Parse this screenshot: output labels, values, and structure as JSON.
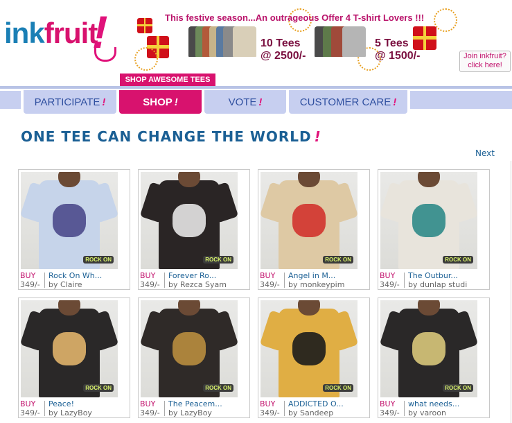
{
  "logo": {
    "part1": "ink",
    "part2": "fruit",
    "bang": "!"
  },
  "banner": {
    "headline": "This festive season...An outrageous Offer 4 T-shirt Lovers !!!",
    "offer_one_line1": "10 Tees",
    "offer_one_line2": "@ 2500/-",
    "offer_two_line1": "5 Tees",
    "offer_two_line2": "@ 1500/-"
  },
  "join": {
    "line1": "Join inkfruit?",
    "line2": "click here!"
  },
  "shop_label": "SHOP AWESOME TEES",
  "nav": {
    "tabs": [
      {
        "label": "PARTICIPATE",
        "bang": "!"
      },
      {
        "label": "SHOP",
        "bang": "!"
      },
      {
        "label": "VOTE",
        "bang": "!"
      },
      {
        "label": "CUSTOMER CARE",
        "bang": "!"
      }
    ],
    "active": "SHOP"
  },
  "page": {
    "title": "ONE TEE CAN CHANGE THE WORLD",
    "title_bang": "!",
    "next_label": "Next"
  },
  "products": [
    {
      "buy": "BUY",
      "name": "Rock On Wh...",
      "price": "349/-",
      "author": "by Claire",
      "shirt_color": "#c6d4ea",
      "print_color": "#4b4a8c",
      "tag": "ROCK ON"
    },
    {
      "buy": "BUY",
      "name": "Forever Ro...",
      "price": "349/-",
      "author": "by Rezca Syam",
      "shirt_color": "#2a2525",
      "print_color": "#e6e6e6",
      "tag": "ROCK ON"
    },
    {
      "buy": "BUY",
      "name": "Angel in M...",
      "price": "349/-",
      "author": "by monkeypim",
      "shirt_color": "#dec9a4",
      "print_color": "#d2332e",
      "tag": "ROCK ON"
    },
    {
      "buy": "BUY",
      "name": "The Outbur...",
      "price": "349/-",
      "author": "by dunlap studi",
      "shirt_color": "#e8e4dc",
      "print_color": "#2f8a88",
      "tag": "ROCK ON"
    },
    {
      "buy": "BUY",
      "name": "Peace!",
      "price": "349/-",
      "author": "by LazyBoy",
      "shirt_color": "#2a2828",
      "print_color": "#e0b36a",
      "tag": "ROCK ON"
    },
    {
      "buy": "BUY",
      "name": "The Peacem...",
      "price": "349/-",
      "author": "by LazyBoy",
      "shirt_color": "#2f2a28",
      "print_color": "#b98d3e",
      "tag": "ROCK ON"
    },
    {
      "buy": "BUY",
      "name": "ADDICTED O...",
      "price": "349/-",
      "author": "by Sandeep",
      "shirt_color": "#e0ae44",
      "print_color": "#1c1c1c",
      "tag": "ROCK ON"
    },
    {
      "buy": "BUY",
      "name": "what needs...",
      "price": "349/-",
      "author": "by varoon",
      "shirt_color": "#2a2828",
      "print_color": "#d8c67a",
      "tag": "ROCK ON"
    }
  ]
}
